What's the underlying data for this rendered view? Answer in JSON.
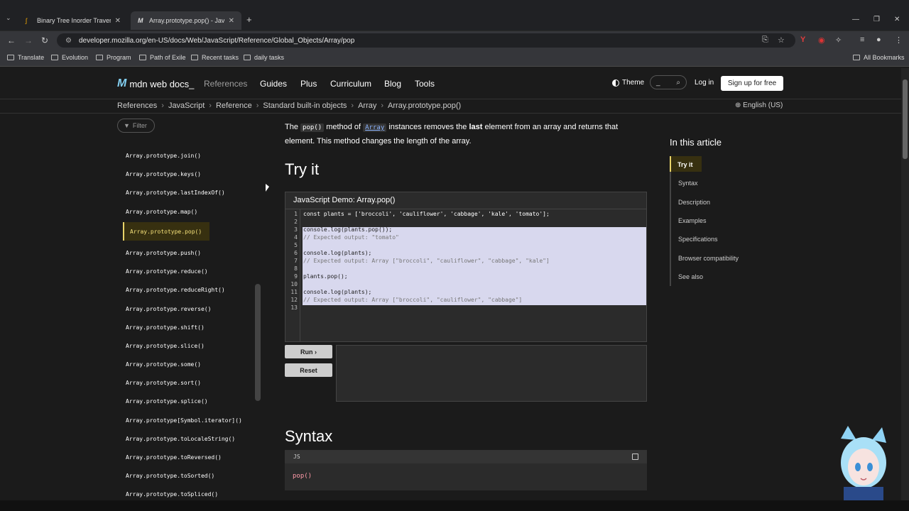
{
  "browser": {
    "tabs": [
      {
        "title": "Binary Tree Inorder Traversal",
        "icon": "leetcode-icon"
      },
      {
        "title": "Array.prototype.pop() - JavaScript",
        "icon": "mdn-icon"
      }
    ],
    "url": "developer.mozilla.org/en-US/docs/Web/JavaScript/Reference/Global_Objects/Array/pop",
    "bookmarks": [
      "Translate",
      "Evolution",
      "Program",
      "Path of Exile",
      "Recent tasks",
      "daily tasks"
    ],
    "all_bookmarks": "All Bookmarks"
  },
  "header": {
    "logo": "mdn web docs_",
    "menu": [
      "References",
      "Guides",
      "Plus",
      "Curriculum",
      "Blog",
      "Tools"
    ],
    "theme": "Theme",
    "search_shortcut": "_",
    "login": "Log in",
    "signup": "Sign up for free"
  },
  "breadcrumbs": [
    "References",
    "JavaScript",
    "Reference",
    "Standard built-in objects",
    "Array",
    "Array.prototype.pop()"
  ],
  "language": "English (US)",
  "sidebar": {
    "filter_placeholder": "Filter",
    "items_before": [
      "Array.prototype.join()",
      "Array.prototype.keys()",
      "Array.prototype.lastIndexOf()",
      "Array.prototype.map()"
    ],
    "active": "Array.prototype.pop()",
    "items_after": [
      "Array.prototype.push()",
      "Array.prototype.reduce()",
      "Array.prototype.reduceRight()",
      "Array.prototype.reverse()",
      "Array.prototype.shift()",
      "Array.prototype.slice()",
      "Array.prototype.some()",
      "Array.prototype.sort()",
      "Array.prototype.splice()",
      "Array.prototype[Symbol.iterator]()",
      "Array.prototype.toLocaleString()",
      "Array.prototype.toReversed()",
      "Array.prototype.toSorted()",
      "Array.prototype.toSpliced()"
    ]
  },
  "article": {
    "intro_the": "The",
    "intro_code": "pop()",
    "intro_method_of": "method of",
    "intro_link": "Array",
    "intro_rest": "instances removes the",
    "intro_bold": "last",
    "intro_tail": "element from an array and returns that element. This method changes the length of the array.",
    "try_it": "Try it",
    "demo_title": "JavaScript Demo: Array.pop()",
    "code_lines": [
      "const plants = ['broccoli', 'cauliflower', 'cabbage', 'kale', 'tomato'];",
      "",
      "console.log(plants.pop());",
      "// Expected output: \"tomato\"",
      "",
      "console.log(plants);",
      "// Expected output: Array [\"broccoli\", \"cauliflower\", \"cabbage\", \"kale\"]",
      "",
      "plants.pop();",
      "",
      "console.log(plants);",
      "// Expected output: Array [\"broccoli\", \"cauliflower\", \"cabbage\"]",
      ""
    ],
    "line_numbers": [
      "1",
      "2",
      "3",
      "4",
      "5",
      "6",
      "7",
      "8",
      "9",
      "10",
      "11",
      "12",
      "13"
    ],
    "run_label": "Run ›",
    "reset_label": "Reset",
    "syntax_heading": "Syntax",
    "syntax_lang": "JS",
    "syntax_code": "pop()"
  },
  "toc": {
    "title": "In this article",
    "items": [
      "Try it",
      "Syntax",
      "Description",
      "Examples",
      "Specifications",
      "Browser compatibility",
      "See also"
    ]
  }
}
